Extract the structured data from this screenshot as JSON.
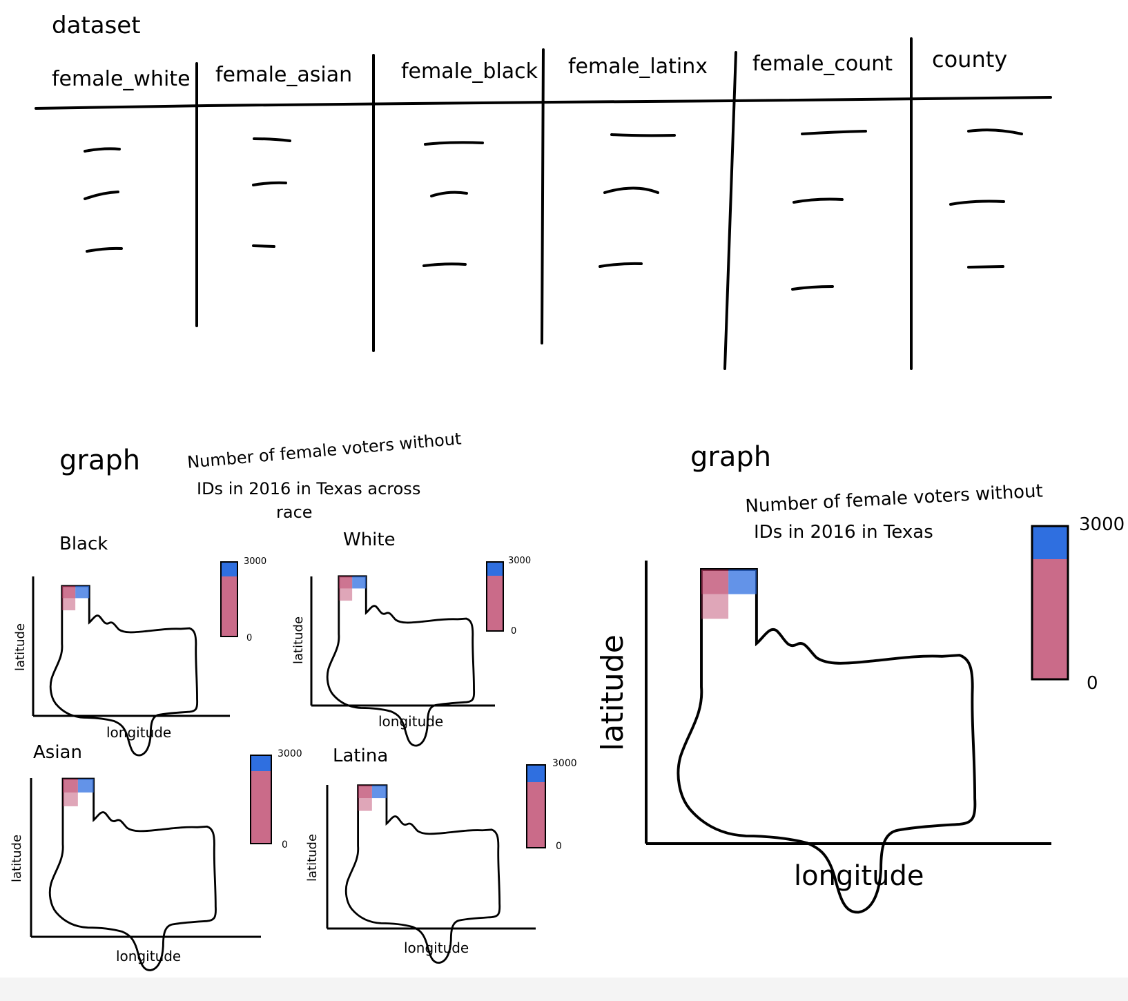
{
  "dataset_label": "dataset",
  "table": {
    "columns": [
      "female_white",
      "female_asian",
      "female_black",
      "female_latinx",
      "female_count",
      "county"
    ]
  },
  "left_section": {
    "graph_label": "graph",
    "title_lines": [
      "Number of female voters without",
      "IDs in 2016 in Texas across",
      "race"
    ],
    "panels": [
      {
        "title": "Black",
        "xlabel": "longitude",
        "ylabel": "latitude",
        "scale_max": "3000",
        "scale_min": "0"
      },
      {
        "title": "White",
        "xlabel": "longitude",
        "ylabel": "latitude",
        "scale_max": "3000",
        "scale_min": "0"
      },
      {
        "title": "Asian",
        "xlabel": "longitude",
        "ylabel": "latitude",
        "scale_max": "3000",
        "scale_min": "0"
      },
      {
        "title": "Latina",
        "xlabel": "longitude",
        "ylabel": "latitude",
        "scale_max": "3000",
        "scale_min": "0"
      }
    ]
  },
  "right_section": {
    "graph_label": "graph",
    "title_lines": [
      "Number of female voters without",
      "IDs in 2016 in Texas"
    ],
    "xlabel": "longitude",
    "ylabel": "latitude",
    "scale_max": "3000",
    "scale_min": "0"
  },
  "colors": {
    "ink": "#000000",
    "blue": "#2f6fe0",
    "crimson": "#b83a62"
  }
}
